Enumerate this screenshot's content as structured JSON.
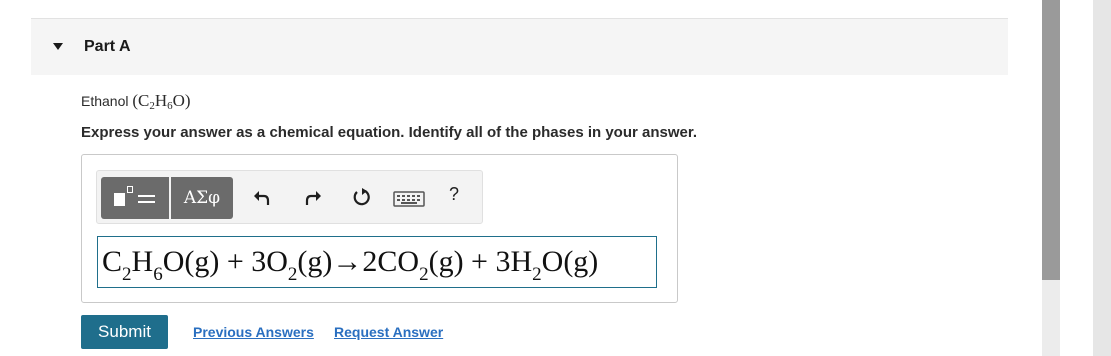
{
  "part": {
    "title": "Part A",
    "caret_icon": "caret-down-icon"
  },
  "question": {
    "prefix": "Ethanol ",
    "formula_open": "(C",
    "formula_sub1": "2",
    "formula_mid": "H",
    "formula_sub2": "6",
    "formula_close": "O)"
  },
  "instructions": "Express your answer as a chemical equation. Identify all of the phases in your answer.",
  "toolbar": {
    "template_icon": "template-icon",
    "greek_label": "ΑΣφ",
    "undo_icon": "undo-icon",
    "redo_icon": "redo-icon",
    "reset_icon": "reset-icon",
    "keyboard_icon": "keyboard-icon",
    "help_label": "?"
  },
  "answer": {
    "t1": "C",
    "s1": "2",
    "t2": "H",
    "s2": "6",
    "t3": "O(g) + 3O",
    "s3": "2",
    "t4": "(g)→2CO",
    "s4": "2",
    "t5": "(g) + 3H",
    "s5": "2",
    "t6": "O(g)"
  },
  "actions": {
    "submit_label": "Submit",
    "previous_answers_label": "Previous Answers",
    "request_answer_label": "Request Answer"
  },
  "colors": {
    "submit_bg": "#1f6e8c",
    "link": "#2a6fc0",
    "toolbar_button": "#6b6b6b"
  }
}
